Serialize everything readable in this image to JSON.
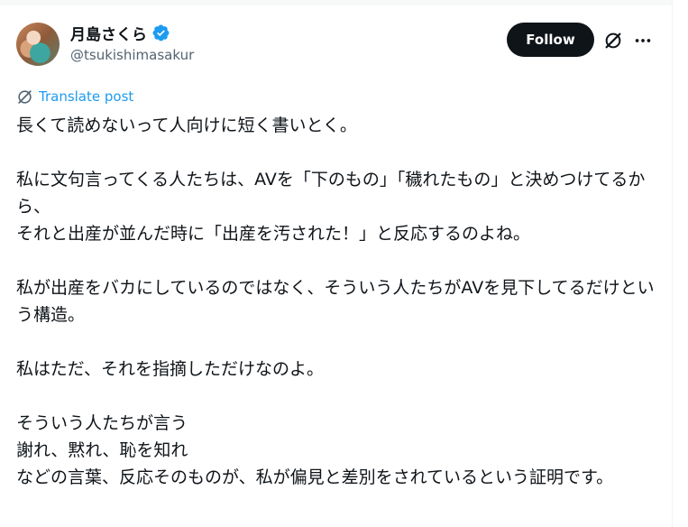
{
  "author": {
    "display_name": "月島さくら",
    "handle": "@tsukishimasakur",
    "verified": true
  },
  "actions": {
    "follow_label": "Follow",
    "grok_icon": "grok-icon",
    "more_icon": "more-icon"
  },
  "translate": {
    "label": "Translate post",
    "icon": "translate-icon"
  },
  "post": {
    "text": "長くて読めないって人向けに短く書いとく。\n\n私に文句言ってくる人たちは、AVを「下のもの」「穢れたもの」と決めつけてるから、\nそれと出産が並んだ時に「出産を汚された！」と反応するのよね。\n\n私が出産をバカにしているのではなく、そういう人たちがAVを見下してるだけという構造。\n\n私はただ、それを指摘しただけなのよ。\n\nそういう人たちが言う\n謝れ、黙れ、恥を知れ\nなどの言葉、反応そのものが、私が偏見と差別をされているという証明です。"
  },
  "colors": {
    "accent": "#1d9bf0",
    "text": "#0f1419",
    "secondary": "#536471",
    "button_bg": "#0f1419"
  }
}
